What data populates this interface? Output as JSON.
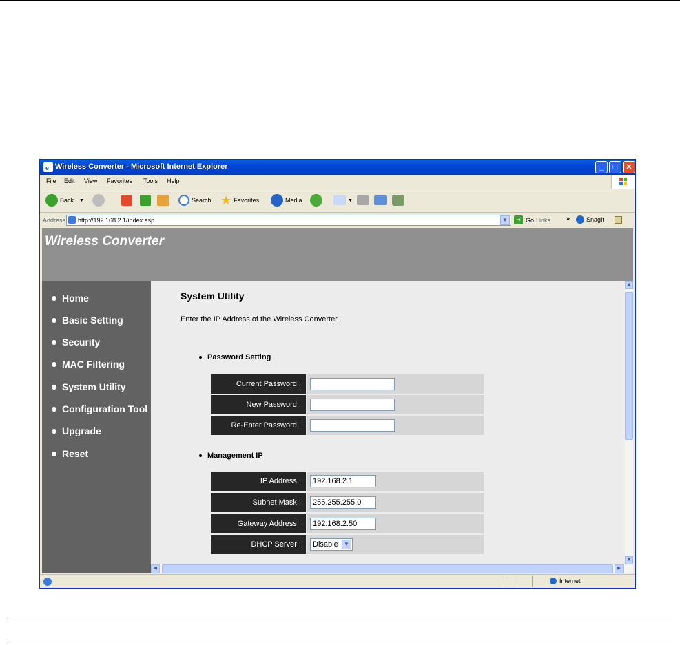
{
  "window": {
    "title": "Wireless Converter - Microsoft Internet Explorer",
    "controls": {
      "minimize": "_",
      "maximize": "□",
      "close": "✕"
    }
  },
  "menubar": [
    "File",
    "Edit",
    "View",
    "Favorites",
    "Tools",
    "Help"
  ],
  "toolbar": {
    "back": "Back",
    "search": "Search",
    "favorites": "Favorites",
    "media": "Media"
  },
  "address": {
    "label": "Address",
    "url": "http://192.168.2.1/index.asp",
    "go": "Go",
    "links": "Links",
    "chevron": "»",
    "snagit": "SnagIt"
  },
  "page": {
    "brand": "Wireless Converter",
    "nav": [
      "Home",
      "Basic Setting",
      "Security",
      "MAC Filtering",
      "System Utility",
      "Configuration Tool",
      "Upgrade",
      "Reset"
    ],
    "title": "System Utility",
    "description": "Enter the IP Address of the Wireless Converter.",
    "password_section": {
      "heading": "Password Setting",
      "fields": [
        {
          "label": "Current Password :",
          "value": ""
        },
        {
          "label": "New Password :",
          "value": ""
        },
        {
          "label": "Re-Enter Password :",
          "value": ""
        }
      ]
    },
    "management_section": {
      "heading": "Management IP",
      "fields": [
        {
          "label": "IP Address :",
          "value": "192.168.2.1"
        },
        {
          "label": "Subnet Mask :",
          "value": "255.255.255.0"
        },
        {
          "label": "Gateway Address :",
          "value": "192.168.2.50"
        },
        {
          "label": "DHCP Server :",
          "value": "Disable"
        }
      ]
    }
  },
  "status": {
    "zone": "Internet"
  },
  "colors": {
    "header_bg": "#909090",
    "sidebar_bg": "#626262",
    "content_bg": "#ececec",
    "label_bg": "#262626",
    "value_bg": "#d6d6d6",
    "xp_title": "#0046d5"
  }
}
